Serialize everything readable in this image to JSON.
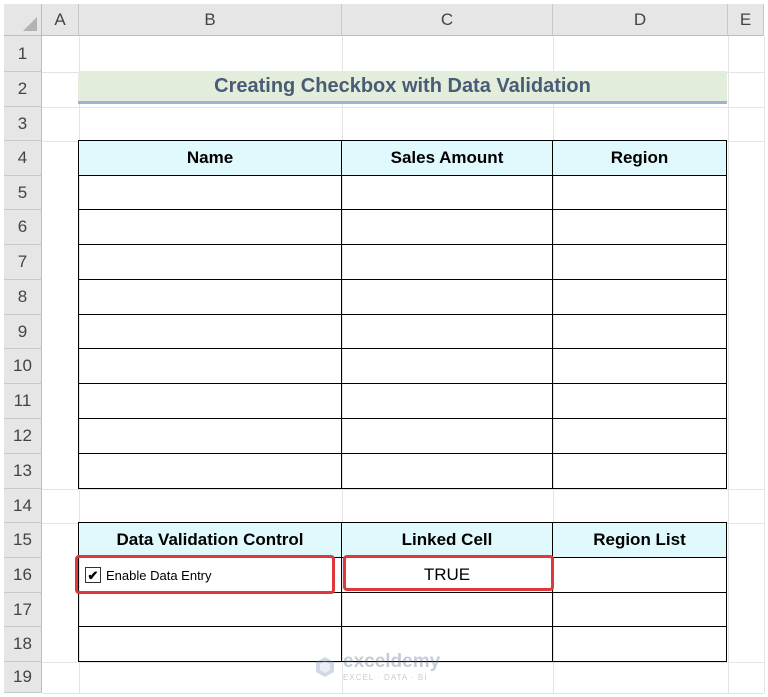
{
  "columns": [
    "A",
    "B",
    "C",
    "D",
    "E"
  ],
  "rows": [
    "1",
    "2",
    "3",
    "4",
    "5",
    "6",
    "7",
    "8",
    "9",
    "10",
    "11",
    "12",
    "13",
    "14",
    "15",
    "16",
    "17",
    "18",
    "19"
  ],
  "title": "Creating Checkbox with Data Validation",
  "table1": {
    "headers": [
      "Name",
      "Sales Amount",
      "Region"
    ]
  },
  "table2": {
    "headers": [
      "Data Validation Control",
      "Linked Cell",
      "Region List"
    ],
    "checkbox_label": "Enable Data Entry",
    "checkbox_checked": true,
    "checkmark": "✔",
    "linked_value": "TRUE"
  },
  "watermark": {
    "name": "exceldemy",
    "tagline": "EXCEL · DATA · BI"
  },
  "colors": {
    "header_fill": "#dff9fc",
    "title_fill": "#e2eedb",
    "highlight": "#e0383a"
  }
}
